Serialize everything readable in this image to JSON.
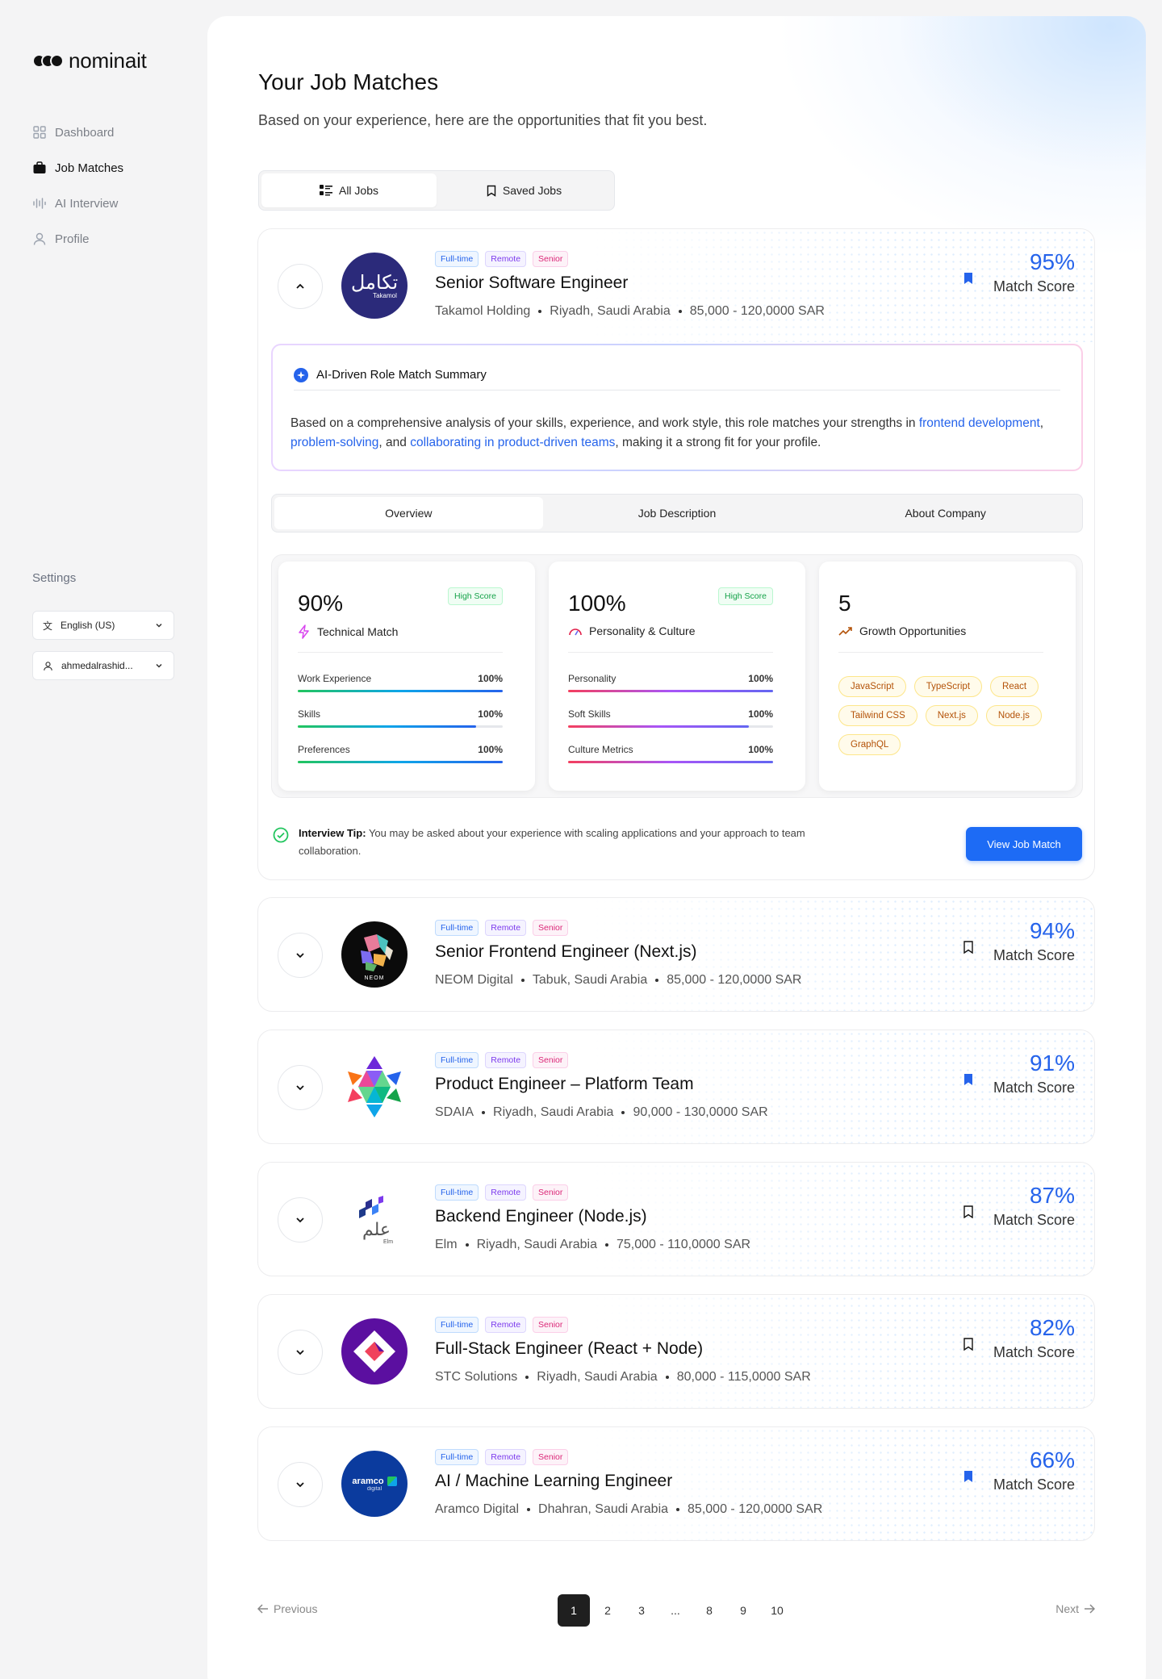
{
  "app": {
    "name": "nominait"
  },
  "sidebar": {
    "items": [
      {
        "label": "Dashboard",
        "icon": "grid-icon"
      },
      {
        "label": "Job Matches",
        "icon": "briefcase-icon",
        "active": true
      },
      {
        "label": "AI Interview",
        "icon": "waveform-icon"
      },
      {
        "label": "Profile",
        "icon": "user-icon"
      }
    ],
    "settings_label": "Settings",
    "language": "English (US)",
    "user": "ahmedalrashid..."
  },
  "page": {
    "title": "Your Job Matches",
    "subtitle": "Based on your experience, here are the opportunities that fit you best.",
    "tabs": {
      "all": "All Jobs",
      "saved": "Saved Jobs"
    }
  },
  "badges": {
    "type": "Full-time",
    "mode": "Remote",
    "level": "Senior"
  },
  "score_label": "Match Score",
  "jobs": [
    {
      "title": "Senior Software Engineer",
      "company": "Takamol Holding",
      "location": "Riyadh, Saudi Arabia",
      "salary": "85,000 - 120,0000 SAR",
      "score": "95%",
      "saved": true,
      "expanded": true,
      "logo": "takamol-logo"
    },
    {
      "title": "Senior Frontend Engineer (Next.js)",
      "company": "NEOM Digital",
      "location": "Tabuk, Saudi Arabia",
      "salary": "85,000 - 120,0000 SAR",
      "score": "94%",
      "saved": false,
      "logo": "neom-logo"
    },
    {
      "title": "Product Engineer – Platform Team",
      "company": "SDAIA",
      "location": "Riyadh, Saudi Arabia",
      "salary": "90,000 - 130,0000 SAR",
      "score": "91%",
      "saved": true,
      "logo": "sdaia-logo"
    },
    {
      "title": "Backend Engineer (Node.js)",
      "company": "Elm",
      "location": "Riyadh, Saudi Arabia",
      "salary": "75,000 - 110,0000 SAR",
      "score": "87%",
      "saved": false,
      "logo": "elm-logo"
    },
    {
      "title": "Full-Stack Engineer (React + Node)",
      "company": "STC Solutions",
      "location": "Riyadh, Saudi Arabia",
      "salary": "80,000 - 115,0000 SAR",
      "score": "82%",
      "saved": false,
      "logo": "stc-logo"
    },
    {
      "title": "AI / Machine Learning Engineer",
      "company": "Aramco Digital",
      "location": "Dhahran, Saudi Arabia",
      "salary": "85,000 - 120,0000 SAR",
      "score": "66%",
      "saved": true,
      "logo": "aramco-logo"
    }
  ],
  "logo_text": {
    "takamol_ar": "تكامل",
    "takamol_en": "Takamol",
    "neom": "NEOM",
    "elm_ar": "علم",
    "elm_en": "Elm",
    "aramco": "aramco",
    "aramco_sub": "digital"
  },
  "summary": {
    "title": "AI-Driven Role Match Summary",
    "text_1": "Based on a comprehensive analysis of your skills, experience, and work style, this role matches your strengths in ",
    "hl_1": "frontend development",
    "text_2": ", ",
    "hl_2": "problem-solving",
    "text_3": ", and ",
    "hl_3": "collaborating in product-driven teams",
    "text_4": ", making it a strong fit for your profile."
  },
  "detail_tabs": [
    "Overview",
    "Job Description",
    "About Company"
  ],
  "metrics": {
    "technical": {
      "value": "90%",
      "badge": "High Score",
      "label": "Technical Match",
      "rows": [
        {
          "label": "Work Experience",
          "value": "100%",
          "fill": 1.0
        },
        {
          "label": "Skills",
          "value": "100%",
          "fill": 0.87
        },
        {
          "label": "Preferences",
          "value": "100%",
          "fill": 1.0
        }
      ]
    },
    "personality": {
      "value": "100%",
      "badge": "High Score",
      "label": "Personality & Culture",
      "rows": [
        {
          "label": "Personality",
          "value": "100%",
          "fill": 1.0
        },
        {
          "label": "Soft Skills",
          "value": "100%",
          "fill": 0.88
        },
        {
          "label": "Culture Metrics",
          "value": "100%",
          "fill": 1.0
        }
      ]
    },
    "growth": {
      "value": "5",
      "label": "Growth Opportunities",
      "chips": [
        "JavaScript",
        "TypeScript",
        "React",
        "Tailwind CSS",
        "Next.js",
        "Node.js",
        "GraphQL"
      ]
    }
  },
  "tip": {
    "label": "Interview Tip:",
    "text": " You may be asked about your experience with scaling applications and your approach to team collaboration."
  },
  "cta": "View Job Match",
  "pagination": {
    "prev": "Previous",
    "next": "Next",
    "pages": [
      "1",
      "2",
      "3",
      "...",
      "8",
      "9",
      "10"
    ],
    "current": "1"
  },
  "colors": {
    "accent": "#2563eb",
    "button": "#1d6bf5"
  }
}
